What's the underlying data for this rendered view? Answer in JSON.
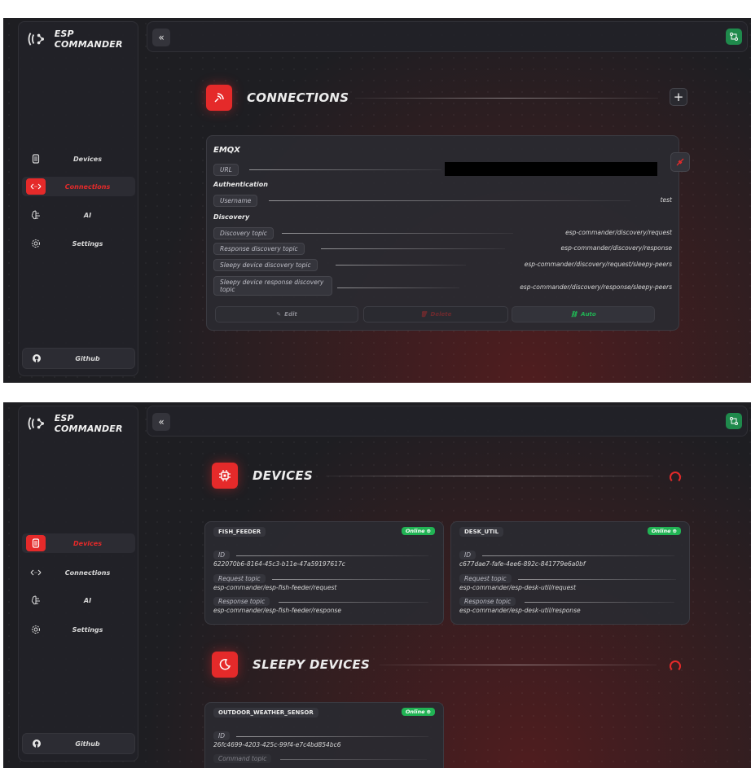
{
  "app": {
    "name": "ESP COMMANDER"
  },
  "sidebar": {
    "items": [
      {
        "label": "Devices",
        "icon": "memory-icon"
      },
      {
        "label": "Connections",
        "icon": "arrows-icon"
      },
      {
        "label": "AI",
        "icon": "brain-icon"
      },
      {
        "label": "Settings",
        "icon": "gear-icon"
      }
    ],
    "github_label": "Github"
  },
  "topbar": {
    "collapse_label": "«",
    "action_icon": "route-icon"
  },
  "connections_view": {
    "active_nav": "Connections",
    "title": "CONNECTIONS",
    "add_label": "+",
    "connection": {
      "name": "EMQX",
      "url_label": "URL",
      "url_value": "",
      "auth_heading": "Authentication",
      "username_label": "Username",
      "username_value": "test",
      "discovery_heading": "Discovery",
      "discovery_topic_label": "Discovery topic",
      "discovery_topic_value": "esp-commander/discovery/request",
      "response_discovery_label": "Response discovery topic",
      "response_discovery_value": "esp-commander/discovery/response",
      "sleepy_discovery_label": "Sleepy device discovery topic",
      "sleepy_discovery_value": "esp-commander/discovery/request/sleepy-peers",
      "sleepy_response_label": "Sleepy device response discovery topic",
      "sleepy_response_value": "esp-commander/discovery/response/sleepy-peers",
      "edit_label": "Edit",
      "delete_label": "Delete",
      "auto_label": "Auto"
    }
  },
  "devices_view": {
    "active_nav": "Devices",
    "devices_title": "DEVICES",
    "sleepy_title": "SLEEPY DEVICES",
    "devices": [
      {
        "name": "FISH_FEEDER",
        "status": "Online",
        "id_label": "ID",
        "id": "622070b6-8164-45c3-b11e-47a59197617c",
        "request_label": "Request topic",
        "request": "esp-commander/esp-fish-feeder/request",
        "response_label": "Response topic",
        "response": "esp-commander/esp-fish-feeder/response"
      },
      {
        "name": "DESK_UTIL",
        "status": "Online",
        "id_label": "ID",
        "id": "c677dae7-fafe-4ee6-892c-841779e6a0bf",
        "request_label": "Request topic",
        "request": "esp-commander/esp-desk-util/request",
        "response_label": "Response topic",
        "response": "esp-commander/esp-desk-util/response"
      }
    ],
    "sleepy_devices": [
      {
        "name": "OUTDOOR_WEATHER_SENSOR",
        "status": "Online",
        "id_label": "ID",
        "id": "26fc4699-4203-425c-99f4-e7c4bd854bc6",
        "command_label": "Command topic"
      }
    ]
  },
  "colors": {
    "accent": "#e52a2a",
    "online": "#21b354",
    "background": "#1e1e22"
  }
}
